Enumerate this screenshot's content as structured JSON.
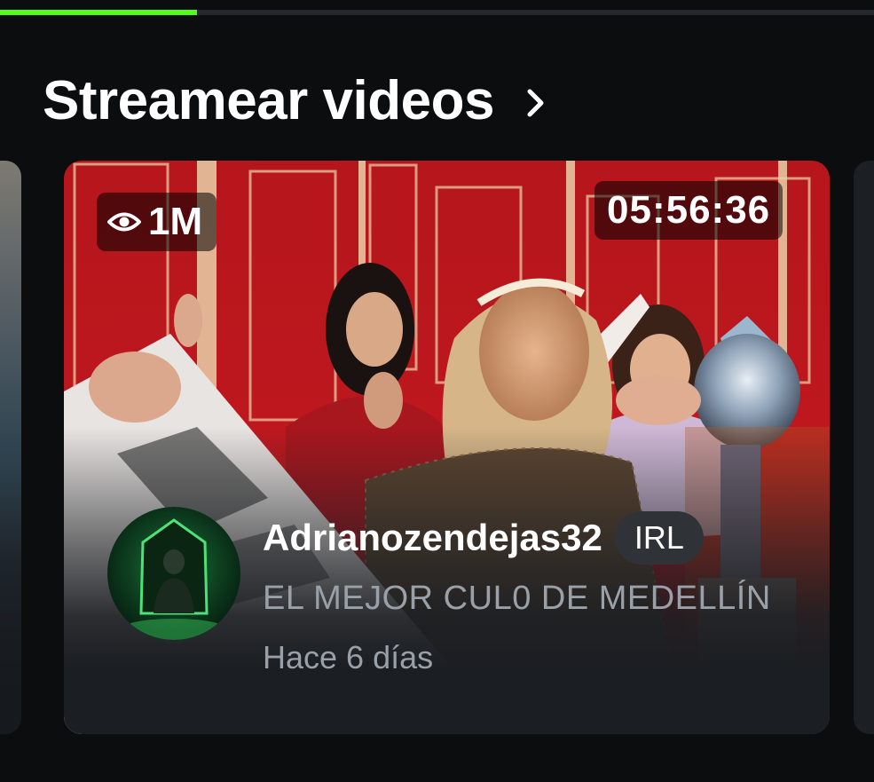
{
  "progress": {
    "fraction": 0.225,
    "color": "#53fc18"
  },
  "section": {
    "title": "Streamear videos",
    "chevron_icon": "chevron-right-icon"
  },
  "video_card": {
    "views": "1M",
    "views_icon": "eye-icon",
    "duration": "05:56:36",
    "channel_name": "Adrianozendejas32",
    "category": "IRL",
    "title": "EL MEJOR CUL0 DE MEDELLÍN",
    "date": "Hace 6 días"
  }
}
